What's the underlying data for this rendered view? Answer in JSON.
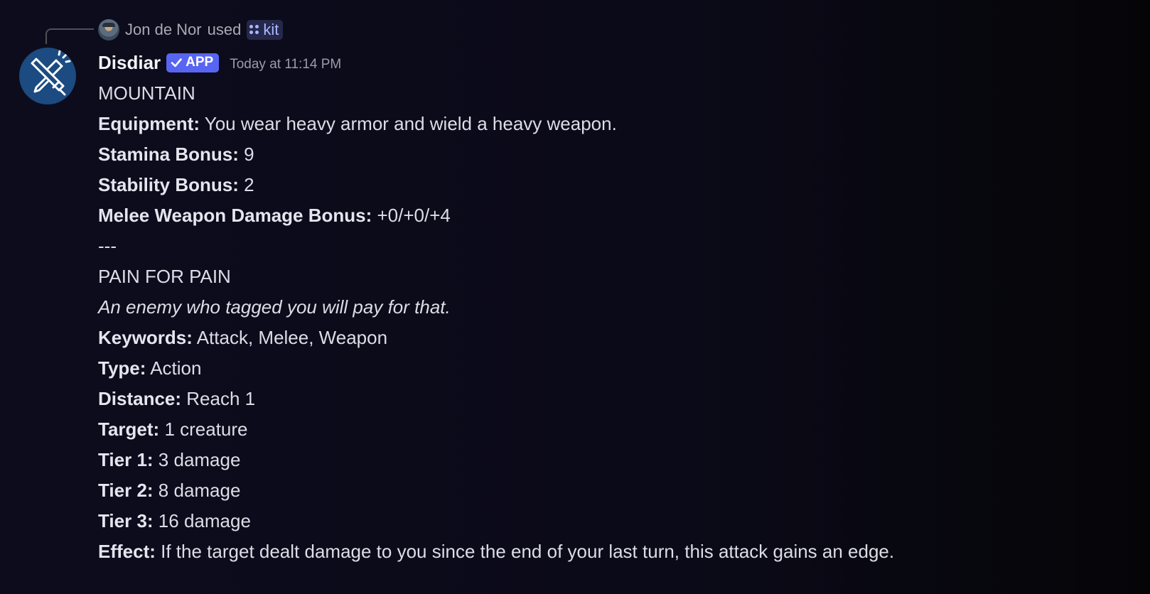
{
  "context": {
    "user": "Jon de Nor",
    "action": "used",
    "command": "kit"
  },
  "message": {
    "author": "Disdiar",
    "badge": "APP",
    "timestamp": "Today at 11:14 PM"
  },
  "lines": [
    {
      "label": "",
      "value": "MOUNTAIN"
    },
    {
      "label": "Equipment:",
      "value": "You wear heavy armor and wield a heavy weapon."
    },
    {
      "label": "Stamina Bonus:",
      "value": "9"
    },
    {
      "label": "Stability Bonus:",
      "value": "2"
    },
    {
      "label": "Melee Weapon Damage Bonus:",
      "value": "+0/+0/+4"
    },
    {
      "label": "",
      "value": "---"
    },
    {
      "label": "",
      "value": "PAIN FOR PAIN"
    },
    {
      "label": "",
      "value": "An enemy who tagged you will pay for that."
    },
    {
      "label": "Keywords:",
      "value": "Attack, Melee, Weapon"
    },
    {
      "label": "Type:",
      "value": "Action"
    },
    {
      "label": "Distance:",
      "value": "Reach 1"
    },
    {
      "label": "Target:",
      "value": "1 creature"
    },
    {
      "label": "Tier 1:",
      "value": "3 damage"
    },
    {
      "label": "Tier 2:",
      "value": "8 damage"
    },
    {
      "label": "Tier 3:",
      "value": "16 damage"
    },
    {
      "label": "Effect:",
      "value": "If the target dealt damage to you since the end of your last turn, this attack gains an edge."
    }
  ],
  "colors": {
    "background": "#0d0c1d",
    "badge": "#5865f2",
    "command_chip": "#25284a",
    "avatar": "#1b4b81"
  },
  "icons": {
    "avatar": "crossed-swords-icon",
    "badge": "checkmark-icon",
    "command": "app-grid-icon"
  }
}
